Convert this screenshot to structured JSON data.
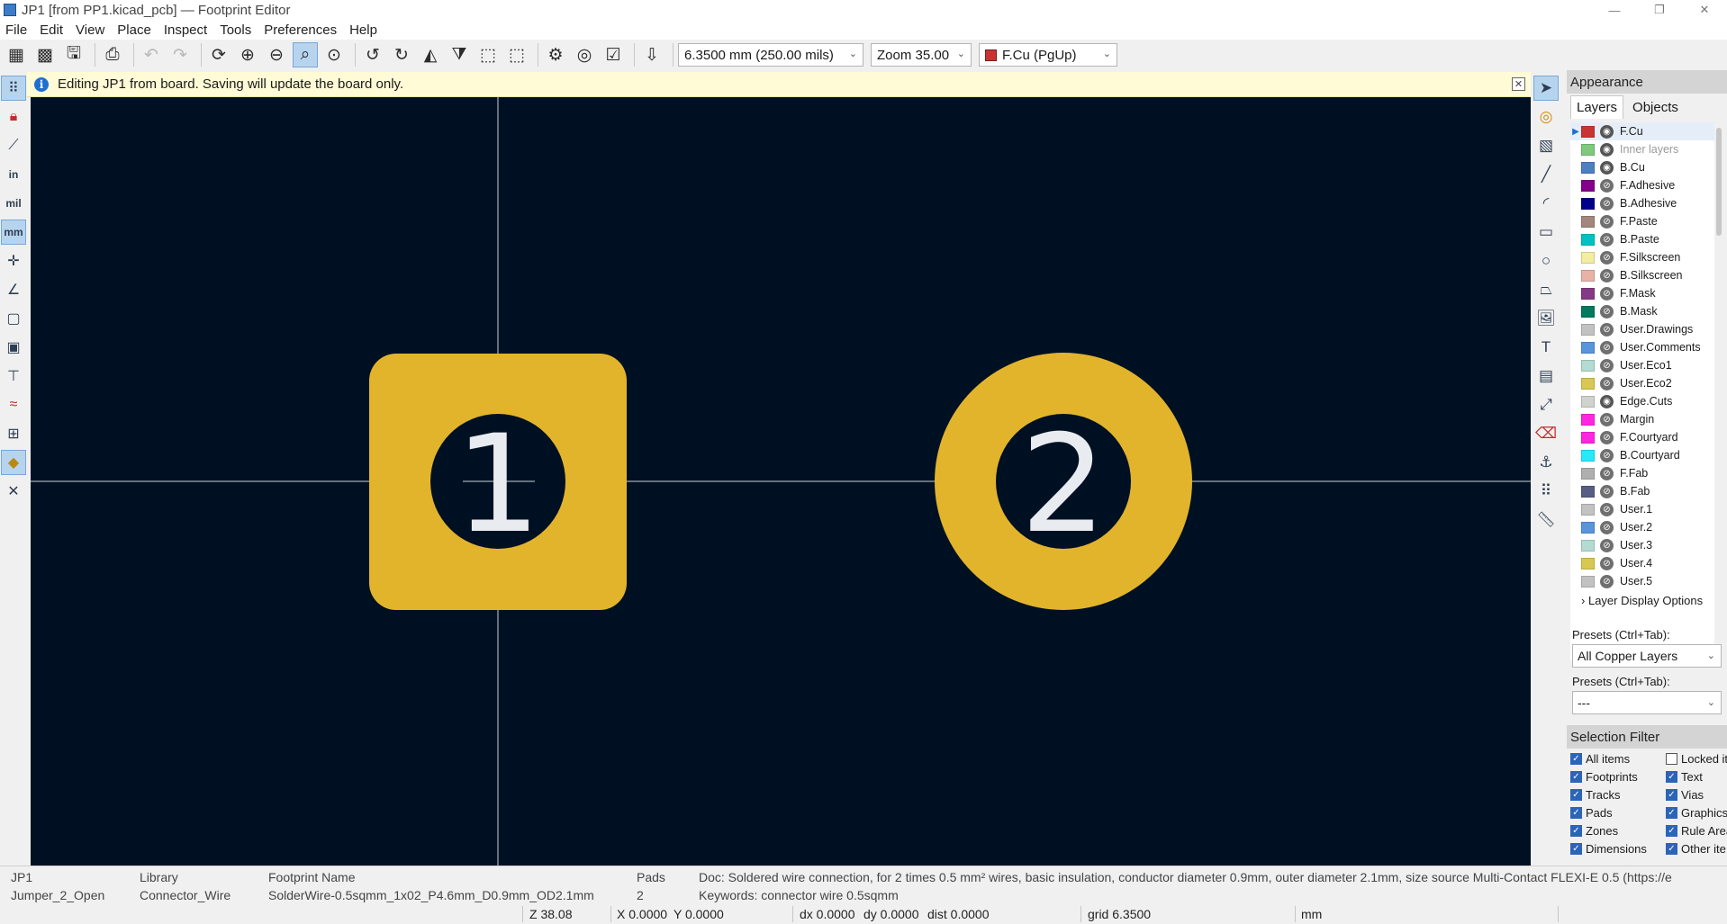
{
  "window": {
    "title": "JP1 [from PP1.kicad_pcb] — Footprint Editor",
    "controls": [
      "—",
      "❐",
      "✕"
    ]
  },
  "menu": [
    "File",
    "Edit",
    "View",
    "Place",
    "Inspect",
    "Tools",
    "Preferences",
    "Help"
  ],
  "toolbar": {
    "grid_value": "6.3500 mm (250.00 mils)",
    "zoom_value": "Zoom 35.00",
    "active_layer": "F.Cu (PgUp)",
    "active_layer_color": "#c83434"
  },
  "info_banner": {
    "message": "Editing JP1 from board.  Saving will update the board only."
  },
  "canvas": {
    "background": "#001023",
    "pad_color": "#e2b42c",
    "pad1_number": "1",
    "pad2_number": "2"
  },
  "left_toolbar": {
    "unit_in": "in",
    "unit_mil": "mil",
    "unit_mm": "mm"
  },
  "appearance": {
    "title": "Appearance",
    "tabs": [
      "Layers",
      "Objects"
    ],
    "layers": [
      {
        "name": "F.Cu",
        "color": "#c83434",
        "visible": true,
        "selected": true
      },
      {
        "name": "Inner layers",
        "color": "#7fc97f",
        "visible": true,
        "dim": true
      },
      {
        "name": "B.Cu",
        "color": "#4d7fc4",
        "visible": true
      },
      {
        "name": "F.Adhesive",
        "color": "#84008c",
        "visible": false
      },
      {
        "name": "B.Adhesive",
        "color": "#00008a",
        "visible": false
      },
      {
        "name": "F.Paste",
        "color": "#a3867c",
        "visible": false
      },
      {
        "name": "B.Paste",
        "color": "#00c2c2",
        "visible": false
      },
      {
        "name": "F.Silkscreen",
        "color": "#f2eda1",
        "visible": false
      },
      {
        "name": "B.Silkscreen",
        "color": "#e8b2a7",
        "visible": false
      },
      {
        "name": "F.Mask",
        "color": "#843a84",
        "visible": false
      },
      {
        "name": "B.Mask",
        "color": "#027a5d",
        "visible": false
      },
      {
        "name": "User.Drawings",
        "color": "#c2c2c2",
        "visible": false
      },
      {
        "name": "User.Comments",
        "color": "#5994dc",
        "visible": false
      },
      {
        "name": "User.Eco1",
        "color": "#b4dbd2",
        "visible": false
      },
      {
        "name": "User.Eco2",
        "color": "#d8c852",
        "visible": false
      },
      {
        "name": "Edge.Cuts",
        "color": "#d0d2cd",
        "visible": true
      },
      {
        "name": "Margin",
        "color": "#ff26e2",
        "visible": false
      },
      {
        "name": "F.Courtyard",
        "color": "#ff26e2",
        "visible": false
      },
      {
        "name": "B.Courtyard",
        "color": "#26e9ff",
        "visible": false
      },
      {
        "name": "F.Fab",
        "color": "#afafaf",
        "visible": false
      },
      {
        "name": "B.Fab",
        "color": "#585d84",
        "visible": false
      },
      {
        "name": "User.1",
        "color": "#c2c2c2",
        "visible": false
      },
      {
        "name": "User.2",
        "color": "#5994dc",
        "visible": false
      },
      {
        "name": "User.3",
        "color": "#b4dbd2",
        "visible": false
      },
      {
        "name": "User.4",
        "color": "#d8c852",
        "visible": false
      },
      {
        "name": "User.5",
        "color": "#c2c2c2",
        "visible": false
      }
    ],
    "layer_display_options": "Layer Display Options",
    "presets_label_1": "Presets (Ctrl+Tab):",
    "preset_value_1": "All Copper Layers",
    "presets_label_2": "Presets (Ctrl+Tab):",
    "preset_value_2": "---"
  },
  "selection_filter": {
    "title": "Selection Filter",
    "left": [
      {
        "label": "All items",
        "checked": true
      },
      {
        "label": "Footprints",
        "checked": true
      },
      {
        "label": "Tracks",
        "checked": true
      },
      {
        "label": "Pads",
        "checked": true
      },
      {
        "label": "Zones",
        "checked": true
      },
      {
        "label": "Dimensions",
        "checked": true
      }
    ],
    "right": [
      {
        "label": "Locked it",
        "checked": false
      },
      {
        "label": "Text",
        "checked": true
      },
      {
        "label": "Vias",
        "checked": true
      },
      {
        "label": "Graphics",
        "checked": true
      },
      {
        "label": "Rule Area",
        "checked": true
      },
      {
        "label": "Other ite",
        "checked": true
      }
    ]
  },
  "message_panel": {
    "ref": "JP1",
    "value": "Jumper_2_Open",
    "library_label": "Library",
    "library_value": "Connector_Wire",
    "fp_name_label": "Footprint Name",
    "fp_name_value": "SolderWire-0.5sqmm_1x02_P4.6mm_D0.9mm_OD2.1mm",
    "pads_label": "Pads",
    "pads_value": "2",
    "doc": "Doc: Soldered wire connection, for 2 times 0.5 mm² wires, basic insulation, conductor diameter 0.9mm, outer diameter 2.1mm, size source Multi-Contact FLEXI-E 0.5 (https://e",
    "keywords": "Keywords: connector wire 0.5sqmm"
  },
  "status_bar": {
    "zoom": "Z 38.08",
    "x": "X 0.0000",
    "y": "Y 0.0000",
    "dx": "dx 0.0000",
    "dy": "dy 0.0000",
    "dist": "dist 0.0000",
    "grid": "grid 6.3500",
    "units": "mm"
  }
}
